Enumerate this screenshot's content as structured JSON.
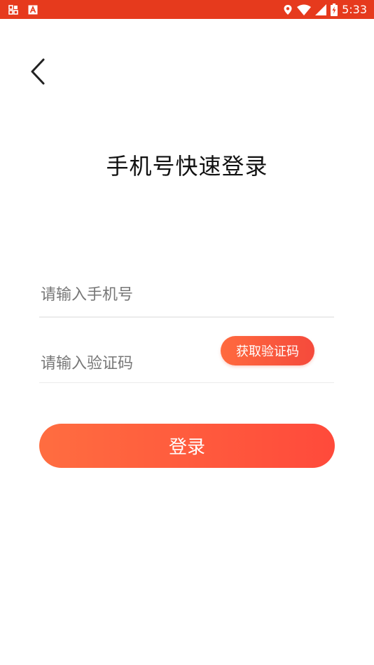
{
  "status_bar": {
    "time": "5:33",
    "left_icons": [
      "grid-notification-icon",
      "font-a-icon"
    ],
    "right_icons": [
      "location-icon",
      "wifi-icon",
      "signal-icon",
      "battery-charging-icon"
    ],
    "background_color": "#e63a1d"
  },
  "header": {
    "back_icon": "chevron-left-icon",
    "title": "手机号快速登录"
  },
  "form": {
    "phone_placeholder": "请输入手机号",
    "phone_value": "",
    "code_placeholder": "请输入验证码",
    "code_value": "",
    "get_code_label": "获取验证码",
    "login_label": "登录"
  },
  "colors": {
    "accent_start": "#ff6d40",
    "accent_end": "#ff4a3b"
  }
}
